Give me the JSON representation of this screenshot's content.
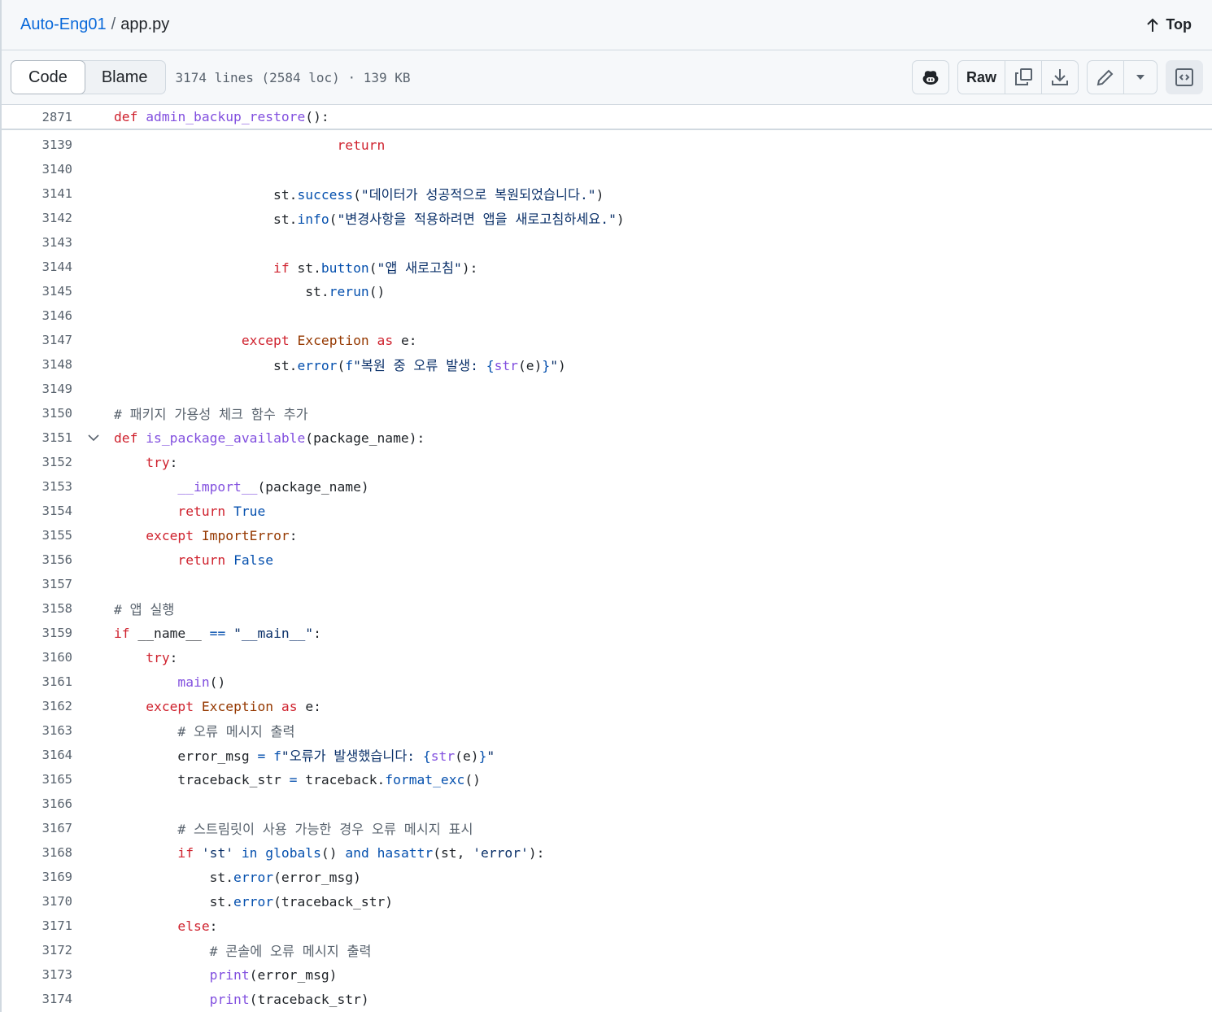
{
  "breadcrumb": {
    "repo": "Auto-Eng01",
    "file": "app.py"
  },
  "top_label": "Top",
  "tabs": {
    "code": "Code",
    "blame": "Blame"
  },
  "file_meta": "3174 lines (2584 loc) · 139 KB",
  "toolbar": {
    "raw": "Raw"
  },
  "sticky": {
    "n": "2871",
    "t": [
      [
        "k",
        "def"
      ],
      [
        "t",
        " "
      ],
      [
        "f",
        "admin_backup_restore"
      ],
      [
        "t",
        "():"
      ]
    ]
  },
  "lines": [
    {
      "n": "3139",
      "t": [
        [
          "t",
          "                            "
        ],
        [
          "k",
          "return"
        ]
      ]
    },
    {
      "n": "3140",
      "t": []
    },
    {
      "n": "3141",
      "t": [
        [
          "t",
          "                    st."
        ],
        [
          "b",
          "success"
        ],
        [
          "t",
          "("
        ],
        [
          "s",
          "\"데이터가 성공적으로 복원되었습니다.\""
        ],
        [
          "t",
          ")"
        ]
      ]
    },
    {
      "n": "3142",
      "t": [
        [
          "t",
          "                    st."
        ],
        [
          "b",
          "info"
        ],
        [
          "t",
          "("
        ],
        [
          "s",
          "\"변경사항을 적용하려면 앱을 새로고침하세요.\""
        ],
        [
          "t",
          ")"
        ]
      ]
    },
    {
      "n": "3143",
      "t": []
    },
    {
      "n": "3144",
      "t": [
        [
          "t",
          "                    "
        ],
        [
          "k",
          "if"
        ],
        [
          "t",
          " st."
        ],
        [
          "b",
          "button"
        ],
        [
          "t",
          "("
        ],
        [
          "s",
          "\"앱 새로고침\""
        ],
        [
          "t",
          "):"
        ]
      ]
    },
    {
      "n": "3145",
      "t": [
        [
          "t",
          "                        st."
        ],
        [
          "b",
          "rerun"
        ],
        [
          "t",
          "()"
        ]
      ]
    },
    {
      "n": "3146",
      "t": []
    },
    {
      "n": "3147",
      "t": [
        [
          "t",
          "                "
        ],
        [
          "k",
          "except"
        ],
        [
          "t",
          " "
        ],
        [
          "e",
          "Exception"
        ],
        [
          "t",
          " "
        ],
        [
          "k",
          "as"
        ],
        [
          "t",
          " e:"
        ]
      ]
    },
    {
      "n": "3148",
      "t": [
        [
          "t",
          "                    st."
        ],
        [
          "b",
          "error"
        ],
        [
          "t",
          "("
        ],
        [
          "b",
          "f"
        ],
        [
          "s",
          "\"복원 중 오류 발생: "
        ],
        [
          "b",
          "{"
        ],
        [
          "f",
          "str"
        ],
        [
          "t",
          "(e)"
        ],
        [
          "b",
          "}"
        ],
        [
          "s",
          "\""
        ],
        [
          "t",
          ")"
        ]
      ]
    },
    {
      "n": "3149",
      "t": []
    },
    {
      "n": "3150",
      "t": [
        [
          "c",
          "# 패키지 가용성 체크 함수 추가"
        ]
      ]
    },
    {
      "n": "3151",
      "fold": true,
      "t": [
        [
          "k",
          "def"
        ],
        [
          "t",
          " "
        ],
        [
          "f",
          "is_package_available"
        ],
        [
          "t",
          "(package_name):"
        ]
      ]
    },
    {
      "n": "3152",
      "t": [
        [
          "t",
          "    "
        ],
        [
          "k",
          "try"
        ],
        [
          "t",
          ":"
        ]
      ]
    },
    {
      "n": "3153",
      "t": [
        [
          "t",
          "        "
        ],
        [
          "f",
          "__import__"
        ],
        [
          "t",
          "(package_name)"
        ]
      ]
    },
    {
      "n": "3154",
      "t": [
        [
          "t",
          "        "
        ],
        [
          "k",
          "return"
        ],
        [
          "t",
          " "
        ],
        [
          "b",
          "True"
        ]
      ]
    },
    {
      "n": "3155",
      "t": [
        [
          "t",
          "    "
        ],
        [
          "k",
          "except"
        ],
        [
          "t",
          " "
        ],
        [
          "e",
          "ImportError"
        ],
        [
          "t",
          ":"
        ]
      ]
    },
    {
      "n": "3156",
      "t": [
        [
          "t",
          "        "
        ],
        [
          "k",
          "return"
        ],
        [
          "t",
          " "
        ],
        [
          "b",
          "False"
        ]
      ]
    },
    {
      "n": "3157",
      "t": []
    },
    {
      "n": "3158",
      "t": [
        [
          "c",
          "# 앱 실행"
        ]
      ]
    },
    {
      "n": "3159",
      "t": [
        [
          "k",
          "if"
        ],
        [
          "t",
          " __name__ "
        ],
        [
          "b",
          "=="
        ],
        [
          "t",
          " "
        ],
        [
          "s",
          "\"__main__\""
        ],
        [
          "t",
          ":"
        ]
      ]
    },
    {
      "n": "3160",
      "t": [
        [
          "t",
          "    "
        ],
        [
          "k",
          "try"
        ],
        [
          "t",
          ":"
        ]
      ]
    },
    {
      "n": "3161",
      "t": [
        [
          "t",
          "        "
        ],
        [
          "f",
          "main"
        ],
        [
          "t",
          "()"
        ]
      ]
    },
    {
      "n": "3162",
      "t": [
        [
          "t",
          "    "
        ],
        [
          "k",
          "except"
        ],
        [
          "t",
          " "
        ],
        [
          "e",
          "Exception"
        ],
        [
          "t",
          " "
        ],
        [
          "k",
          "as"
        ],
        [
          "t",
          " e:"
        ]
      ]
    },
    {
      "n": "3163",
      "t": [
        [
          "t",
          "        "
        ],
        [
          "c",
          "# 오류 메시지 출력"
        ]
      ]
    },
    {
      "n": "3164",
      "t": [
        [
          "t",
          "        error_msg "
        ],
        [
          "b",
          "="
        ],
        [
          "t",
          " "
        ],
        [
          "b",
          "f"
        ],
        [
          "s",
          "\"오류가 발생했습니다: "
        ],
        [
          "b",
          "{"
        ],
        [
          "f",
          "str"
        ],
        [
          "t",
          "(e)"
        ],
        [
          "b",
          "}"
        ],
        [
          "s",
          "\""
        ]
      ]
    },
    {
      "n": "3165",
      "t": [
        [
          "t",
          "        traceback_str "
        ],
        [
          "b",
          "="
        ],
        [
          "t",
          " traceback."
        ],
        [
          "b",
          "format_exc"
        ],
        [
          "t",
          "()"
        ]
      ]
    },
    {
      "n": "3166",
      "t": []
    },
    {
      "n": "3167",
      "t": [
        [
          "t",
          "        "
        ],
        [
          "c",
          "# 스트림릿이 사용 가능한 경우 오류 메시지 표시"
        ]
      ]
    },
    {
      "n": "3168",
      "t": [
        [
          "t",
          "        "
        ],
        [
          "k",
          "if"
        ],
        [
          "t",
          " "
        ],
        [
          "s",
          "'st'"
        ],
        [
          "t",
          " "
        ],
        [
          "b",
          "in"
        ],
        [
          "t",
          " "
        ],
        [
          "b",
          "globals"
        ],
        [
          "t",
          "() "
        ],
        [
          "b",
          "and"
        ],
        [
          "t",
          " "
        ],
        [
          "b",
          "hasattr"
        ],
        [
          "t",
          "(st, "
        ],
        [
          "s",
          "'error'"
        ],
        [
          "t",
          "):"
        ]
      ]
    },
    {
      "n": "3169",
      "t": [
        [
          "t",
          "            st."
        ],
        [
          "b",
          "error"
        ],
        [
          "t",
          "(error_msg)"
        ]
      ]
    },
    {
      "n": "3170",
      "t": [
        [
          "t",
          "            st."
        ],
        [
          "b",
          "error"
        ],
        [
          "t",
          "(traceback_str)"
        ]
      ]
    },
    {
      "n": "3171",
      "t": [
        [
          "t",
          "        "
        ],
        [
          "k",
          "else"
        ],
        [
          "t",
          ":"
        ]
      ]
    },
    {
      "n": "3172",
      "t": [
        [
          "t",
          "            "
        ],
        [
          "c",
          "# 콘솔에 오류 메시지 출력"
        ]
      ]
    },
    {
      "n": "3173",
      "t": [
        [
          "t",
          "            "
        ],
        [
          "f",
          "print"
        ],
        [
          "t",
          "(error_msg)"
        ]
      ]
    },
    {
      "n": "3174",
      "t": [
        [
          "t",
          "            "
        ],
        [
          "f",
          "print"
        ],
        [
          "t",
          "(traceback_str)"
        ]
      ]
    }
  ]
}
